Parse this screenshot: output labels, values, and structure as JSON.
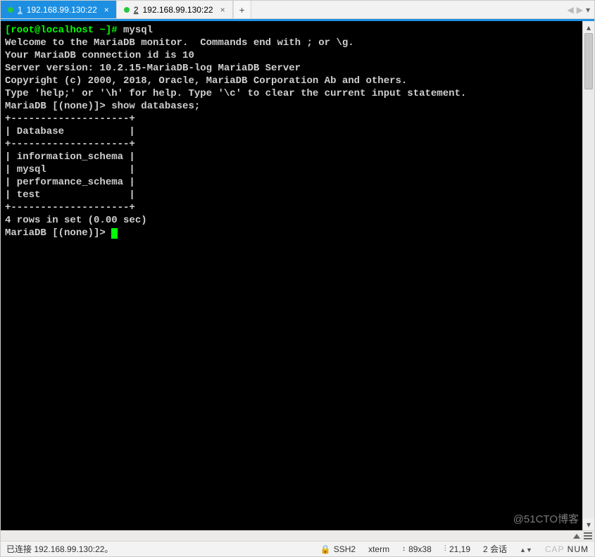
{
  "tabs": [
    {
      "num": "1",
      "label": "192.168.99.130:22",
      "active": true
    },
    {
      "num": "2",
      "label": "192.168.99.130:22",
      "active": false
    }
  ],
  "add_tab": "+",
  "nav": {
    "left": "◀",
    "right": "▶",
    "down": "▾"
  },
  "terminal": {
    "lines": [
      {
        "segments": [
          {
            "t": "[root@localhost ~]# ",
            "green": true
          },
          {
            "t": "mysql"
          }
        ]
      },
      {
        "segments": [
          {
            "t": "Welcome to the MariaDB monitor.  Commands end with ; or \\g."
          }
        ]
      },
      {
        "segments": [
          {
            "t": "Your MariaDB connection id is 10"
          }
        ]
      },
      {
        "segments": [
          {
            "t": "Server version: 10.2.15-MariaDB-log MariaDB Server"
          }
        ]
      },
      {
        "segments": [
          {
            "t": ""
          }
        ]
      },
      {
        "segments": [
          {
            "t": "Copyright (c) 2000, 2018, Oracle, MariaDB Corporation Ab and others."
          }
        ]
      },
      {
        "segments": [
          {
            "t": ""
          }
        ]
      },
      {
        "segments": [
          {
            "t": "Type 'help;' or '\\h' for help. Type '\\c' to clear the current input statement."
          }
        ]
      },
      {
        "segments": [
          {
            "t": ""
          }
        ]
      },
      {
        "segments": [
          {
            "t": "MariaDB [(none)]> show databases;"
          }
        ]
      },
      {
        "segments": [
          {
            "t": "+--------------------+"
          }
        ]
      },
      {
        "segments": [
          {
            "t": "| Database           |"
          }
        ]
      },
      {
        "segments": [
          {
            "t": "+--------------------+"
          }
        ]
      },
      {
        "segments": [
          {
            "t": "| information_schema |"
          }
        ]
      },
      {
        "segments": [
          {
            "t": "| mysql              |"
          }
        ]
      },
      {
        "segments": [
          {
            "t": "| performance_schema |"
          }
        ]
      },
      {
        "segments": [
          {
            "t": "| test               |"
          }
        ]
      },
      {
        "segments": [
          {
            "t": "+--------------------+"
          }
        ]
      },
      {
        "segments": [
          {
            "t": "4 rows in set (0.00 sec)"
          }
        ]
      },
      {
        "segments": [
          {
            "t": ""
          }
        ]
      },
      {
        "segments": [
          {
            "t": "MariaDB [(none)]> "
          }
        ],
        "cursor": true
      }
    ]
  },
  "status": {
    "connection": "已连接 192.168.99.130:22。",
    "lock_icon": "🔒",
    "protocol": "SSH2",
    "termtype": "xterm",
    "size_icon": "↕",
    "size": "89x38",
    "pos_icon": "ⵗ",
    "pos": "21,19",
    "sessions": "2 会话",
    "cap": "CAP",
    "num": "NUM"
  },
  "watermark": "@51CTO博客"
}
